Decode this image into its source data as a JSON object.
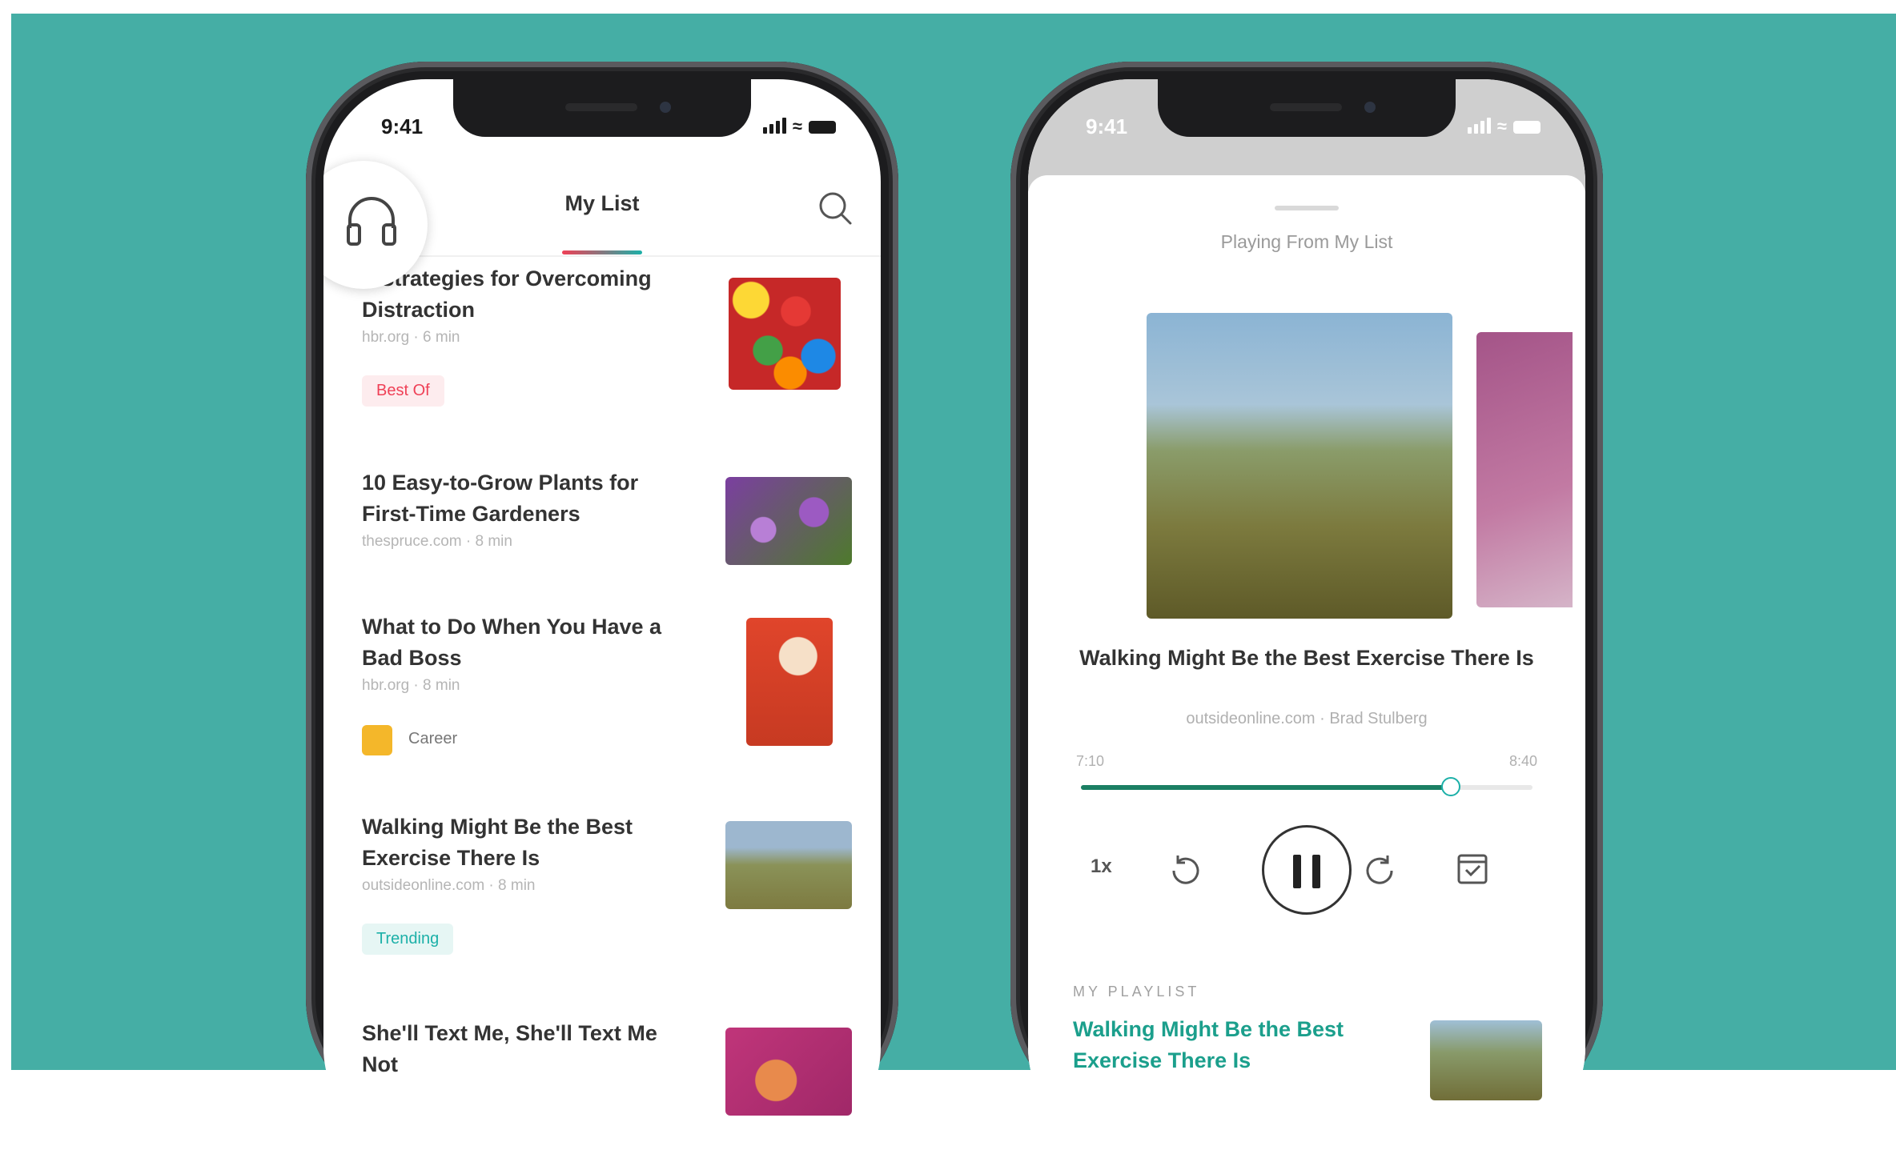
{
  "left_phone": {
    "status_time": "9:41",
    "title": "My List",
    "items": [
      {
        "title": "4 Strategies for Overcoming Distraction",
        "meta": "hbr.org · 6 min",
        "badge": "Best Of",
        "thumb_colors": [
          "#e53935",
          "#43a047",
          "#fdd835",
          "#1e88e5"
        ]
      },
      {
        "title": "10 Easy-to-Grow Plants for First-Time Gardeners",
        "meta": "thespruce.com · 8 min",
        "thumb_colors": [
          "#7b3fa0",
          "#9c5ac2",
          "#4e7a2c"
        ]
      },
      {
        "title": "What to Do When You Have a Bad Boss",
        "meta": "hbr.org · 8 min",
        "badge": "Career",
        "thumb_colors": [
          "#e0452b",
          "#f6b24a"
        ]
      },
      {
        "title": "Walking Might Be the Best Exercise There Is",
        "meta": "outsideonline.com · 8 min",
        "badge": "Trending",
        "thumb_colors": [
          "#9db7cf",
          "#7d7a40"
        ]
      },
      {
        "title": "She'll Text Me, She'll Text Me Not",
        "meta": "",
        "thumb_colors": [
          "#c0357a",
          "#e88a4c"
        ]
      }
    ]
  },
  "right_phone": {
    "status_time": "9:41",
    "playing_from": "Playing From My List",
    "now_playing_title": "Walking Might Be the Best Exercise There Is",
    "now_playing_meta": "outsideonline.com · Brad Stulberg",
    "time_elapsed": "7:10",
    "time_remaining": "8:40",
    "progress_fraction": 0.82,
    "speed_label": "1x",
    "playlist_label": "MY PLAYLIST",
    "playlist_next_title": "Walking Might Be the Best Exercise There Is"
  },
  "colors": {
    "background": "#45aea5",
    "accent_red": "#ef4056",
    "accent_teal": "#1cb0a8",
    "progress": "#1b7f63"
  }
}
